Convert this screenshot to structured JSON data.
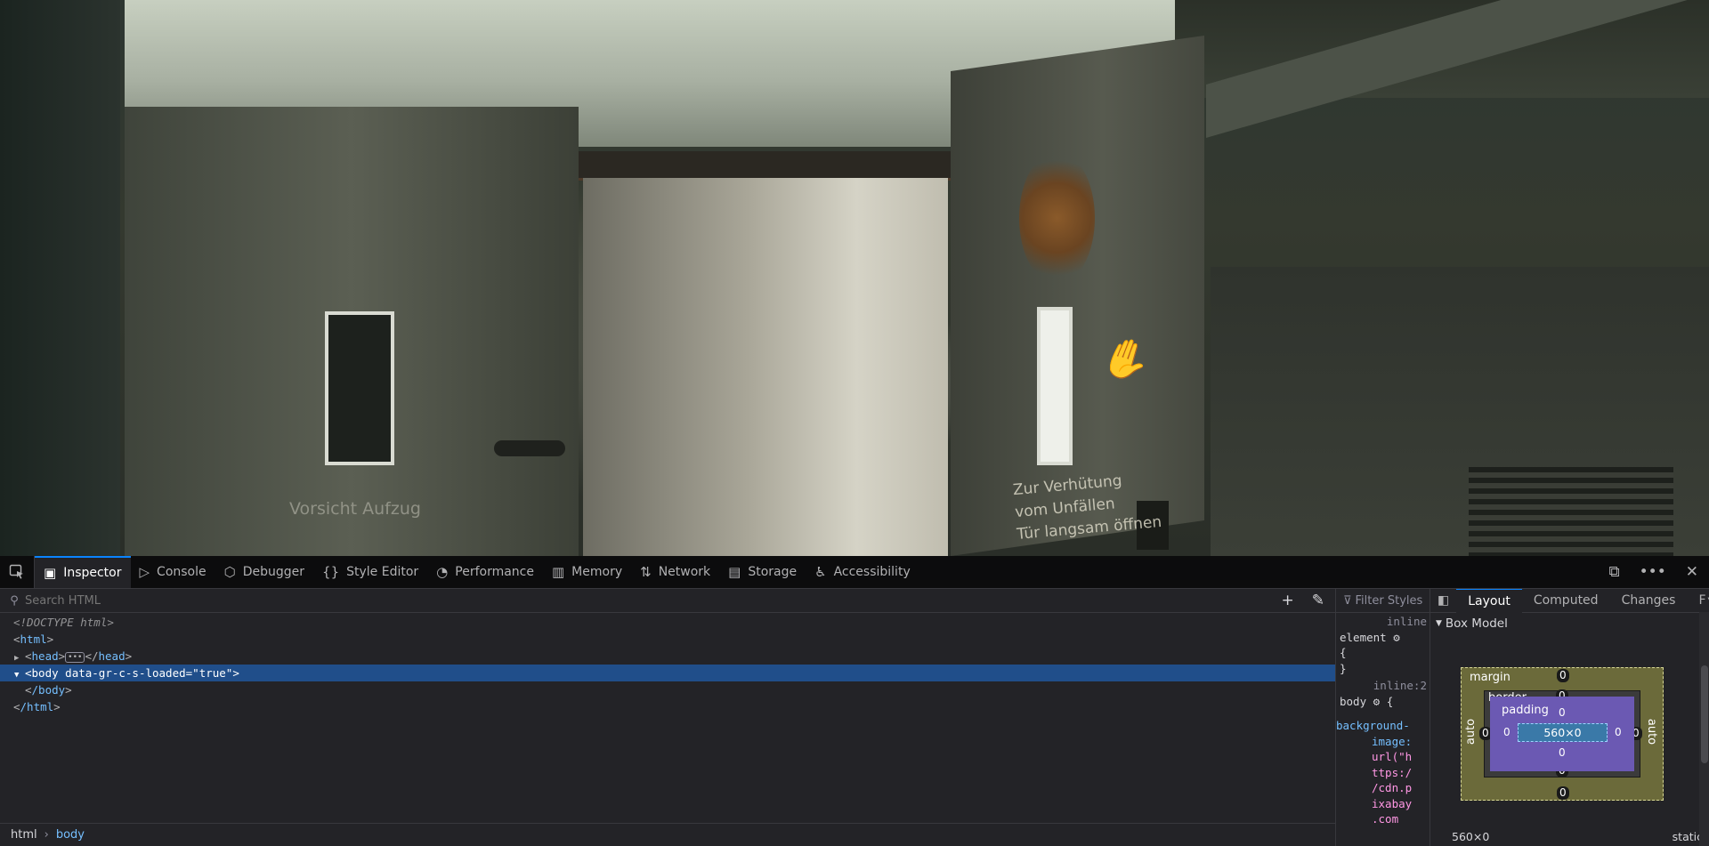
{
  "photo": {
    "sign_left": "Vorsicht  Aufzug",
    "sign_right": "Zur Verhütung\nvom Unfällen\nTür langsam öffnen"
  },
  "devtools": {
    "tabs": [
      {
        "label": "Inspector",
        "icon": "inspector-icon",
        "selected": true
      },
      {
        "label": "Console",
        "icon": "console-icon"
      },
      {
        "label": "Debugger",
        "icon": "debugger-icon"
      },
      {
        "label": "Style Editor",
        "icon": "style-editor-icon"
      },
      {
        "label": "Performance",
        "icon": "performance-icon"
      },
      {
        "label": "Memory",
        "icon": "memory-icon"
      },
      {
        "label": "Network",
        "icon": "network-icon"
      },
      {
        "label": "Storage",
        "icon": "storage-icon"
      },
      {
        "label": "Accessibility",
        "icon": "accessibility-icon"
      }
    ],
    "search": {
      "placeholder": "Search HTML"
    },
    "markup": {
      "doctype": "<!DOCTYPE html>",
      "html_open": "html",
      "head": "head",
      "body_tag": "body",
      "body_attr": "data-gr-c-s-loaded",
      "body_attr_value": "\"true\"",
      "body_close": "/body",
      "html_close": "/html"
    },
    "breadcrumbs": [
      "html",
      "body"
    ],
    "rules": {
      "filter_placeholder": "Filter Styles",
      "rule1_source": "inline",
      "rule1_selector": "element",
      "rule1_open": "{",
      "rule1_close": "}",
      "rule2_source": "inline:2",
      "rule2_selector": "body",
      "rule2_open": "{",
      "prop": "background-",
      "prop2": "image:",
      "val_lines": [
        "url(\"h",
        "ttps:/",
        "/cdn.p",
        "ixabay",
        ".com"
      ]
    },
    "side": {
      "tabs": [
        "Layout",
        "Computed",
        "Changes",
        "F"
      ],
      "section": "Box Model",
      "box": {
        "margin_label": "margin",
        "border_label": "border",
        "padding_label": "padding",
        "content": "560×0",
        "margin_top": "0",
        "margin_bottom": "0",
        "margin_left": "auto",
        "margin_right": "auto",
        "border_top": "0",
        "border_bottom": "0",
        "border_left": "0",
        "border_right": "0",
        "padding_top": "0",
        "padding_bottom": "0",
        "padding_left": "0",
        "padding_right": "0"
      },
      "size": "560×0",
      "position": "static"
    }
  }
}
